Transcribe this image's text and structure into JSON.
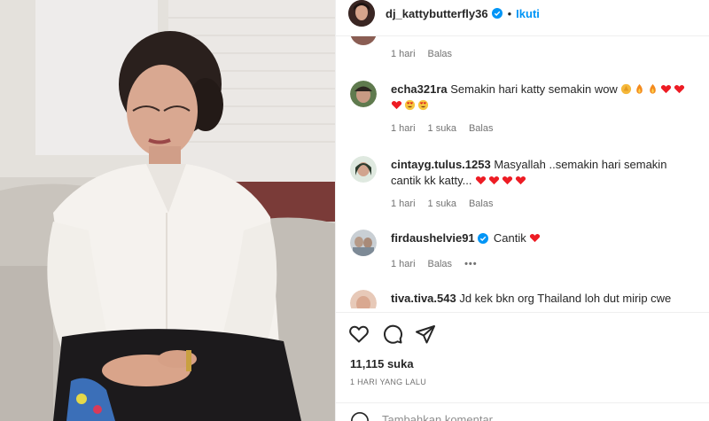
{
  "post": {
    "username": "dj_kattybutterfly36",
    "follow_label": "Ikuti",
    "dot": "•",
    "likes_text": "11,115 suka",
    "timestamp": "1 HARI YANG LALU"
  },
  "comments": [
    {
      "username": "",
      "text": "",
      "time": "1 hari",
      "likes": "",
      "reply": "Balas"
    },
    {
      "username": "echa321ra",
      "text": "Semakin hari katty semakin wow",
      "emojis": [
        "clap-emoji",
        "fire-emoji",
        "fire-emoji",
        "heart-emoji",
        "heart-emoji",
        "heart-emoji",
        "heart-eyes-emoji",
        "heart-eyes-emoji"
      ],
      "time": "1 hari",
      "likes": "1 suka",
      "reply": "Balas"
    },
    {
      "username": "cintayg.tulus.1253",
      "text": "Masyallah ..semakin hari semakin cantik kk katty...",
      "emojis": [
        "heart-emoji",
        "heart-emoji",
        "heart-emoji",
        "heart-emoji"
      ],
      "time": "1 hari",
      "likes": "1 suka",
      "reply": "Balas"
    },
    {
      "username": "firdaushelvie91",
      "text": "Cantik",
      "emojis": [
        "heart-emoji"
      ],
      "time": "1 hari",
      "likes": "",
      "reply": "Balas",
      "more": "•••"
    },
    {
      "username": "tiva.tiva.543",
      "text": "Jd kek bkn org Thailand loh dut mirip cwe brazil",
      "time": "",
      "likes": "",
      "reply": ""
    }
  ],
  "add_comment": {
    "placeholder": "Tambahkan komentar..."
  },
  "icons": {
    "like": "heart-outline-icon",
    "comment": "comment-bubble-icon",
    "share": "paper-plane-icon",
    "emoji": "smiley-icon",
    "verified": "verified-badge-icon"
  },
  "colors": {
    "accent": "#0095f6",
    "text": "#262626",
    "secondary": "#737373",
    "heart": "#ed1c24"
  }
}
